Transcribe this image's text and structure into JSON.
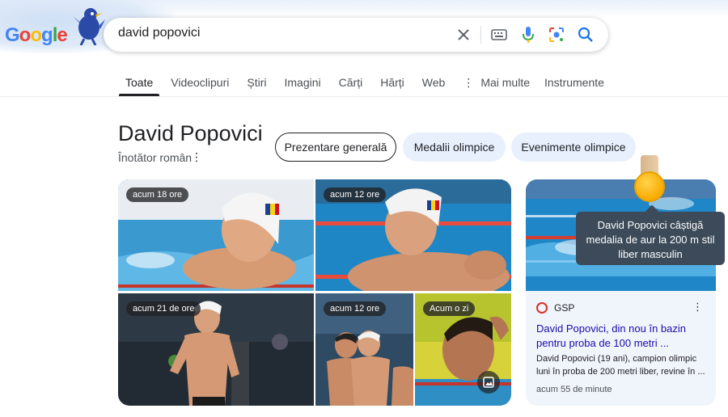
{
  "header": {
    "logo_letters": [
      "G",
      "o",
      "o",
      "g",
      "l",
      "e"
    ],
    "logo_colors": [
      "#4285f4",
      "#ea4335",
      "#fbbc05",
      "#4285f4",
      "#34a853",
      "#ea4335"
    ]
  },
  "search": {
    "query": "david popovici",
    "icons": [
      "clear-icon",
      "keyboard-icon",
      "mic-icon",
      "lens-icon",
      "search-icon"
    ]
  },
  "tabs": [
    {
      "label": "Toate",
      "active": true
    },
    {
      "label": "Videoclipuri"
    },
    {
      "label": "Știri"
    },
    {
      "label": "Imagini"
    },
    {
      "label": "Cărți"
    },
    {
      "label": "Hărți"
    },
    {
      "label": "Web"
    },
    {
      "label": "Mai multe"
    }
  ],
  "tools_label": "Instrumente",
  "entity": {
    "title": "David Popovici",
    "subtitle": "Înotător român",
    "chips": [
      "Prezentare generală",
      "Medalii olimpice",
      "Evenimente olimpice"
    ]
  },
  "images": [
    {
      "time": "acum 18 ore"
    },
    {
      "time": "acum 12 ore"
    },
    {
      "time": "acum 21 de ore"
    },
    {
      "time": "acum 12 ore"
    },
    {
      "time": "Acum o zi"
    }
  ],
  "card": {
    "source": "GSP",
    "title": "David Popovici, din nou în bazin pentru proba de 100 metri ...",
    "snippet": "David Popovici (19 ani), campion olimpic luni în proba de 200 metri liber, revine în ...",
    "time": "acum 55 de minute"
  },
  "tooltip": {
    "text": "David Popovici câștigă medalia de aur la 200 m stil liber masculin"
  },
  "colors": {
    "accent": "#1a73e8",
    "link": "#1a0dab",
    "chip_fill": "#e8f0fe",
    "gold": "#f9ab00"
  }
}
